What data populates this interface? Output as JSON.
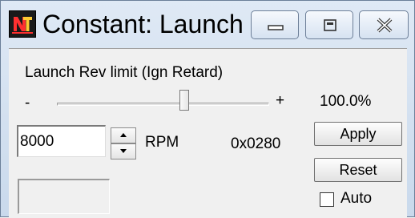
{
  "window": {
    "title": "Constant: Launch ...",
    "app_icon": "nt-logo-icon",
    "caption_buttons": [
      "minimize-icon",
      "maximize-icon",
      "close-icon"
    ]
  },
  "constant": {
    "description": "Launch Rev limit (Ign Retard)",
    "slider": {
      "minus_label": "-",
      "plus_label": "+",
      "percent_text": "100.0%",
      "level": 0.6
    },
    "value": "8000",
    "unit": "RPM",
    "hex": "0x0280"
  },
  "buttons": {
    "apply": "Apply",
    "reset": "Reset"
  },
  "auto": {
    "label": "Auto",
    "checked": false
  }
}
